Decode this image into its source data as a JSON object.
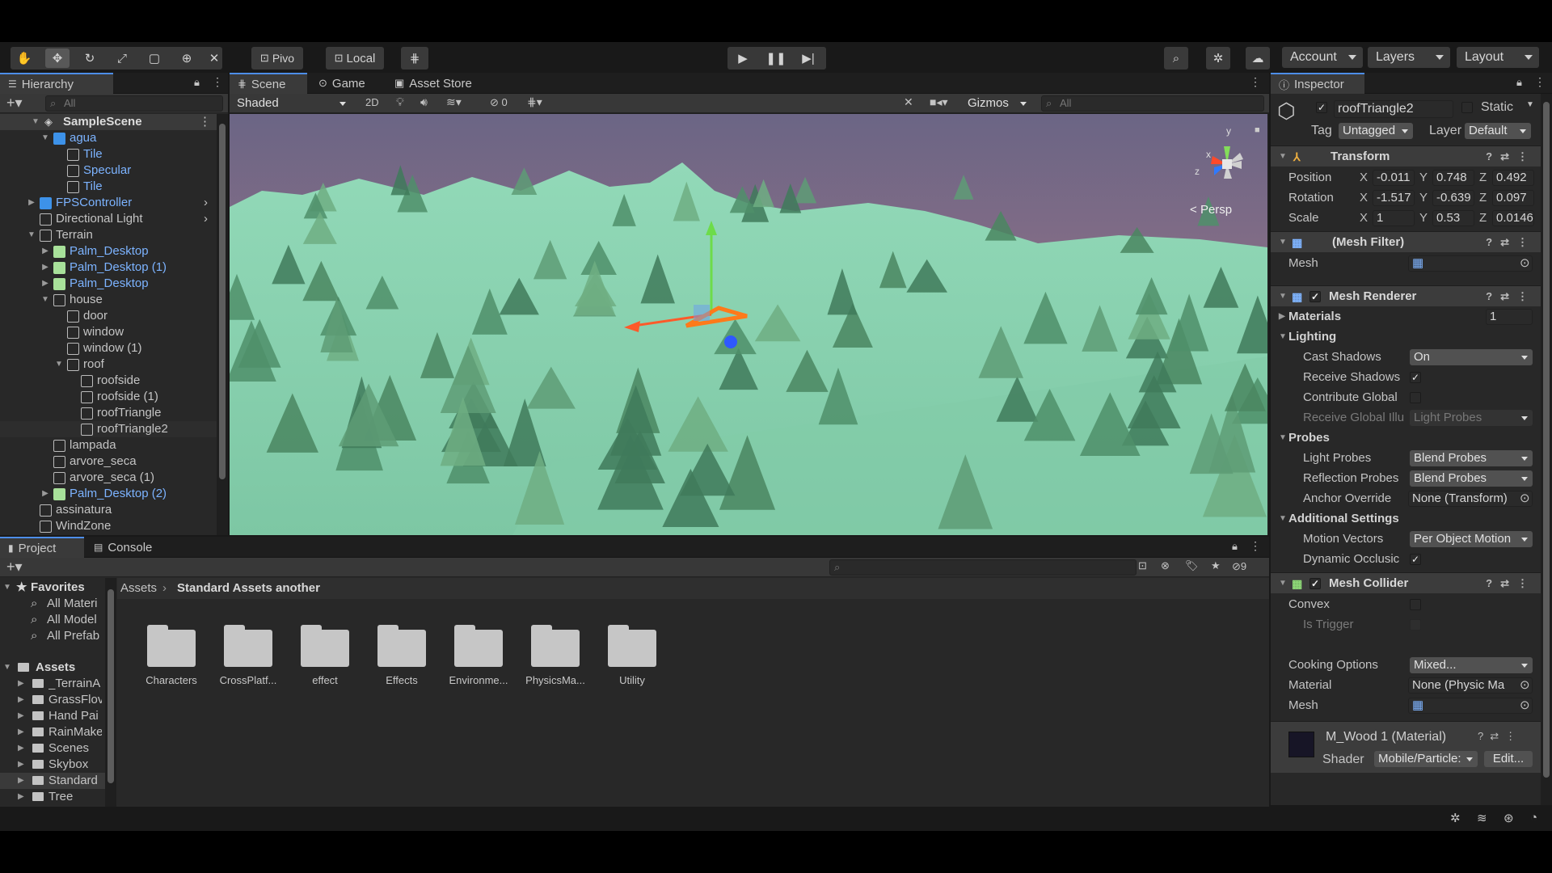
{
  "toolbar": {
    "pivot_label": "Pivo",
    "local_label": "Local",
    "account_label": "Account",
    "layers_label": "Layers",
    "layout_label": "Layout"
  },
  "hierarchy": {
    "tab": "Hierarchy",
    "search_placeholder": "All",
    "scene": "SampleScene",
    "items": [
      {
        "label": "agua",
        "prefab": true
      },
      {
        "label": "Tile",
        "prefab": true
      },
      {
        "label": "Specular",
        "prefab": true
      },
      {
        "label": "Tile",
        "prefab": true
      },
      {
        "label": "FPSController",
        "prefab": true
      },
      {
        "label": "Directional Light",
        "prefab": false
      },
      {
        "label": "Terrain",
        "prefab": false
      },
      {
        "label": "Palm_Desktop",
        "prefab": true
      },
      {
        "label": "Palm_Desktop (1)",
        "prefab": true
      },
      {
        "label": "Palm_Desktop",
        "prefab": true
      },
      {
        "label": "house",
        "prefab": false
      },
      {
        "label": "door",
        "prefab": false
      },
      {
        "label": "window",
        "prefab": false
      },
      {
        "label": "window (1)",
        "prefab": false
      },
      {
        "label": "roof",
        "prefab": false
      },
      {
        "label": "roofside",
        "prefab": false
      },
      {
        "label": "roofside (1)",
        "prefab": false
      },
      {
        "label": "roofTriangle",
        "prefab": false
      },
      {
        "label": "roofTriangle2",
        "prefab": false
      },
      {
        "label": "lampada",
        "prefab": false
      },
      {
        "label": "arvore_seca",
        "prefab": false
      },
      {
        "label": "arvore_seca (1)",
        "prefab": false
      },
      {
        "label": "Palm_Desktop (2)",
        "prefab": true
      },
      {
        "label": "assinatura",
        "prefab": false
      },
      {
        "label": "WindZone",
        "prefab": false
      }
    ]
  },
  "scene": {
    "tabs": [
      "Scene",
      "Game",
      "Asset Store"
    ],
    "shading": "Shaded",
    "mode_2d": "2D",
    "hidden_count": "0",
    "gizmos": "Gizmos",
    "search_placeholder": "All",
    "persp": "Persp",
    "axis_y": "y",
    "axis_x": "x",
    "axis_z": "z"
  },
  "project": {
    "tabs": [
      "Project",
      "Console"
    ],
    "favorites_label": "Favorites",
    "favorites": [
      "All Materi",
      "All Model",
      "All Prefab"
    ],
    "assets_label": "Assets",
    "folders_tree": [
      "_TerrainA",
      "GrassFlov",
      "Hand Pai",
      "RainMake",
      "Scenes",
      "Skybox",
      "Standard",
      "Tree"
    ],
    "breadcrumb": [
      "Assets",
      "Standard Assets another"
    ],
    "hidden_count": "9",
    "folders": [
      "Characters",
      "CrossPlatf...",
      "effect",
      "Effects",
      "Environme...",
      "PhysicsMa...",
      "Utility"
    ]
  },
  "inspector": {
    "tab": "Inspector",
    "object_name": "roofTriangle2",
    "static_label": "Static",
    "tag_label": "Tag",
    "tag_value": "Untagged",
    "layer_label": "Layer",
    "layer_value": "Default",
    "transform": {
      "title": "Transform",
      "position_label": "Position",
      "position": [
        "-0.011",
        "0.748",
        "0.492"
      ],
      "rotation_label": "Rotation",
      "rotation": [
        "-1.517",
        "-0.639",
        "0.097"
      ],
      "scale_label": "Scale",
      "scale": [
        "1",
        "0.53",
        "0.0146"
      ]
    },
    "mesh_filter": {
      "title": "(Mesh Filter)",
      "mesh_label": "Mesh"
    },
    "mesh_renderer": {
      "title": "Mesh Renderer",
      "materials_label": "Materials",
      "materials_count": "1",
      "lighting_label": "Lighting",
      "cast_shadows_label": "Cast Shadows",
      "cast_shadows": "On",
      "receive_shadows_label": "Receive Shadows",
      "contribute_gi_label": "Contribute Global",
      "receive_gi_label": "Receive Global Illu",
      "receive_gi": "Light Probes",
      "probes_label": "Probes",
      "light_probes_label": "Light Probes",
      "light_probes": "Blend Probes",
      "reflection_probes_label": "Reflection Probes",
      "reflection_probes": "Blend Probes",
      "anchor_label": "Anchor Override",
      "anchor": "None (Transform)",
      "additional_label": "Additional Settings",
      "motion_vectors_label": "Motion Vectors",
      "motion_vectors": "Per Object Motion",
      "dynamic_occlusion_label": "Dynamic Occlusic"
    },
    "mesh_collider": {
      "title": "Mesh Collider",
      "convex_label": "Convex",
      "trigger_label": "Is Trigger",
      "cooking_label": "Cooking Options",
      "cooking": "Mixed...",
      "material_label": "Material",
      "material": "None (Physic Ma",
      "mesh_label": "Mesh"
    },
    "material": {
      "title": "M_Wood 1 (Material)",
      "shader_label": "Shader",
      "shader": "Mobile/Particle:",
      "edit_label": "Edit..."
    }
  },
  "colors": {
    "accent": "#4d8ee9",
    "prefab": "#7cb3ff",
    "terrain": "#8fd6b4",
    "panel": "#282828"
  }
}
